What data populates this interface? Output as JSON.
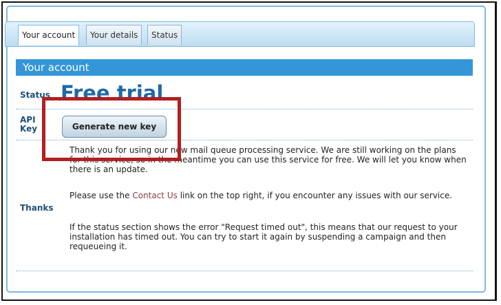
{
  "tabs": [
    {
      "label": "Your account"
    },
    {
      "label": "Your details"
    },
    {
      "label": "Status"
    }
  ],
  "section": {
    "title": "Your account"
  },
  "status": {
    "label": "Status",
    "value": "Free trial"
  },
  "api_key": {
    "label_line1": "API",
    "label_line2": "Key",
    "button_label": "Generate new key"
  },
  "thanks": {
    "label": "Thanks",
    "p1": "Thank you for using our new mail queue processing service. We are still working on the plans for this service, so in the meantime you can use this service for free. We will let you know when there is an update.",
    "p2_before": "Please use the ",
    "p2_link": "Contact Us",
    "p2_after": " link on the top right, if you encounter any issues with our service.",
    "p3": "If the status section shows the error \"Request timed out\", this means that our request to your installation has timed out. You can try to start it again by suspending a campaign and then requeueing it."
  },
  "colors": {
    "header_bg": "#3496d8",
    "status_text": "#1e6aa5",
    "highlight_box": "#b21f1f",
    "link": "#8a3d3d"
  }
}
